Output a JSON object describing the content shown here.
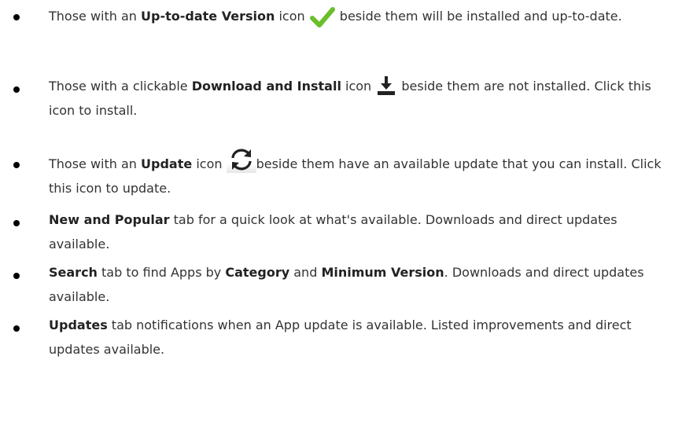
{
  "items": [
    {
      "pre": "Those with an ",
      "bold": "Up-to-date Version",
      "mid": " icon ",
      "icon": "checkmark-icon",
      "post": " beside them will be installed and up-to-date."
    },
    {
      "pre": "Those with a clickable ",
      "bold": "Download and Install",
      "mid": " icon ",
      "icon": "download-icon",
      "post": " beside them are not installed. Click this icon to install."
    },
    {
      "pre": "Those with an ",
      "bold": "Update",
      "mid": " icon ",
      "icon": "refresh-icon",
      "post": "beside them have an available update that you can install. Click this icon to update."
    },
    {
      "bold": "New and Popular",
      "post": " tab for a quick look at what's available. Downloads and direct updates available."
    },
    {
      "bold": "Search",
      "mid": " tab to find Apps by ",
      "bold2": "Category",
      "mid2": " and ",
      "bold3": "Minimum Version",
      "post": ". Downloads and direct updates available."
    },
    {
      "bold": "Updates",
      "post": " tab notifications when an App update is available. Listed improvements and direct updates available."
    }
  ],
  "colors": {
    "text": "#333333",
    "check": "#6bbf2a",
    "icon_dark": "#222222"
  }
}
